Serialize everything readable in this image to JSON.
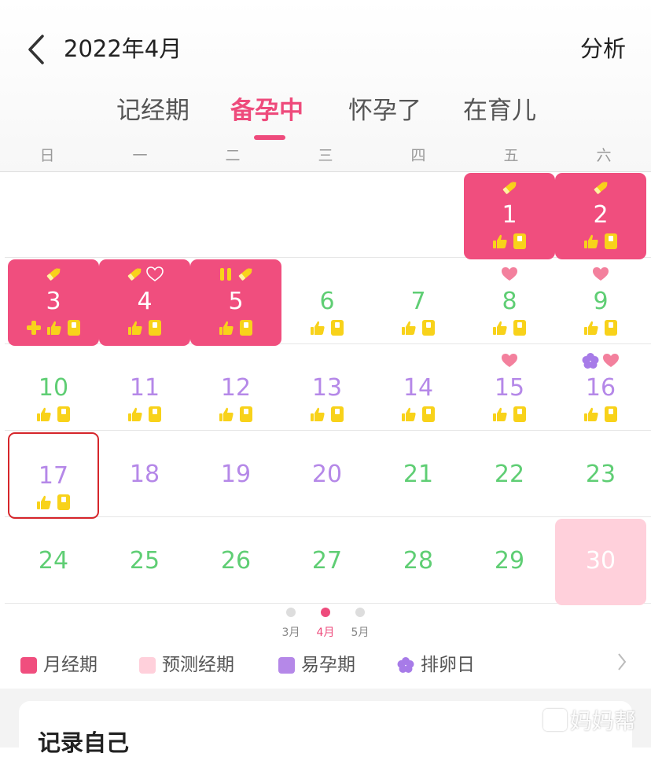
{
  "header": {
    "title": "2022年4月",
    "right_action": "分析"
  },
  "tabs": [
    {
      "label": "记经期",
      "active": false
    },
    {
      "label": "备孕中",
      "active": true
    },
    {
      "label": "怀孕了",
      "active": false
    },
    {
      "label": "在育儿",
      "active": false
    }
  ],
  "weekdays": [
    "日",
    "一",
    "二",
    "三",
    "四",
    "五",
    "六"
  ],
  "days": [
    {
      "d": "1",
      "type": "period",
      "top": [
        "pencil-icon"
      ],
      "bottom": [
        "thumb-up-icon",
        "notebook-icon"
      ]
    },
    {
      "d": "2",
      "type": "period",
      "top": [
        "pencil-icon"
      ],
      "bottom": [
        "thumb-up-icon",
        "notebook-icon"
      ]
    },
    {
      "d": "3",
      "type": "period",
      "top": [
        "pencil-icon"
      ],
      "bottom": [
        "plus-icon",
        "thumb-up-icon",
        "notebook-icon"
      ]
    },
    {
      "d": "4",
      "type": "period",
      "top": [
        "pencil-icon",
        "heart-outline-icon"
      ],
      "bottom": [
        "thumb-up-icon",
        "notebook-icon"
      ]
    },
    {
      "d": "5",
      "type": "period",
      "top": [
        "pause-icon",
        "pencil-icon"
      ],
      "bottom": [
        "thumb-up-icon",
        "notebook-icon"
      ]
    },
    {
      "d": "6",
      "type": "green",
      "top": [],
      "bottom": [
        "thumb-up-icon",
        "notebook-icon"
      ]
    },
    {
      "d": "7",
      "type": "green",
      "top": [],
      "bottom": [
        "thumb-up-icon",
        "notebook-icon"
      ]
    },
    {
      "d": "8",
      "type": "green",
      "top": [
        "heart-icon"
      ],
      "bottom": [
        "thumb-up-icon",
        "notebook-icon"
      ]
    },
    {
      "d": "9",
      "type": "green",
      "top": [
        "heart-icon"
      ],
      "bottom": [
        "thumb-up-icon",
        "notebook-icon"
      ]
    },
    {
      "d": "10",
      "type": "green",
      "top": [],
      "bottom": [
        "thumb-up-icon",
        "notebook-icon"
      ]
    },
    {
      "d": "11",
      "type": "purple",
      "top": [],
      "bottom": [
        "thumb-up-icon",
        "notebook-icon"
      ]
    },
    {
      "d": "12",
      "type": "purple",
      "top": [],
      "bottom": [
        "thumb-up-icon",
        "notebook-icon"
      ]
    },
    {
      "d": "13",
      "type": "purple",
      "top": [],
      "bottom": [
        "thumb-up-icon",
        "notebook-icon"
      ]
    },
    {
      "d": "14",
      "type": "purple",
      "top": [],
      "bottom": [
        "thumb-up-icon",
        "notebook-icon"
      ]
    },
    {
      "d": "15",
      "type": "purple",
      "top": [
        "heart-icon"
      ],
      "bottom": [
        "thumb-up-icon",
        "notebook-icon"
      ]
    },
    {
      "d": "16",
      "type": "purple",
      "top": [
        "ovulation-flower-icon",
        "heart-icon"
      ],
      "bottom": [
        "thumb-up-icon",
        "notebook-icon"
      ]
    },
    {
      "d": "17",
      "type": "purple",
      "today": true,
      "top": [],
      "bottom": [
        "thumb-up-icon",
        "notebook-icon"
      ]
    },
    {
      "d": "18",
      "type": "purple",
      "top": [],
      "bottom": []
    },
    {
      "d": "19",
      "type": "purple",
      "top": [],
      "bottom": []
    },
    {
      "d": "20",
      "type": "purple",
      "top": [],
      "bottom": []
    },
    {
      "d": "21",
      "type": "green",
      "top": [],
      "bottom": []
    },
    {
      "d": "22",
      "type": "green",
      "top": [],
      "bottom": []
    },
    {
      "d": "23",
      "type": "green",
      "top": [],
      "bottom": []
    },
    {
      "d": "24",
      "type": "green",
      "top": [],
      "bottom": []
    },
    {
      "d": "25",
      "type": "green",
      "top": [],
      "bottom": []
    },
    {
      "d": "26",
      "type": "green",
      "top": [],
      "bottom": []
    },
    {
      "d": "27",
      "type": "green",
      "top": [],
      "bottom": []
    },
    {
      "d": "28",
      "type": "green",
      "top": [],
      "bottom": []
    },
    {
      "d": "29",
      "type": "green",
      "top": [],
      "bottom": []
    },
    {
      "d": "30",
      "type": "predicted",
      "top": [],
      "bottom": []
    }
  ],
  "month_pager": [
    {
      "label": "3月",
      "active": false
    },
    {
      "label": "4月",
      "active": true
    },
    {
      "label": "5月",
      "active": false
    }
  ],
  "legend": [
    {
      "label": "月经期",
      "color": "#f04e7e",
      "shape": "square"
    },
    {
      "label": "预测经期",
      "color": "#ffd0db",
      "shape": "square"
    },
    {
      "label": "易孕期",
      "color": "#b588e8",
      "shape": "square"
    },
    {
      "label": "排卵日",
      "color": "#a77be8",
      "shape": "flower"
    }
  ],
  "section": {
    "title": "记录自己"
  },
  "watermark": {
    "text": "妈妈帮"
  },
  "colors": {
    "accent": "#ee4b7c",
    "period": "#f04e7e",
    "predicted": "#ffd0db",
    "safe_green": "#5fce74",
    "fertile_purple": "#b588e8",
    "icon_yellow": "#f8d21a",
    "heart_pink": "#f3809d",
    "today_border": "#d6262b"
  }
}
